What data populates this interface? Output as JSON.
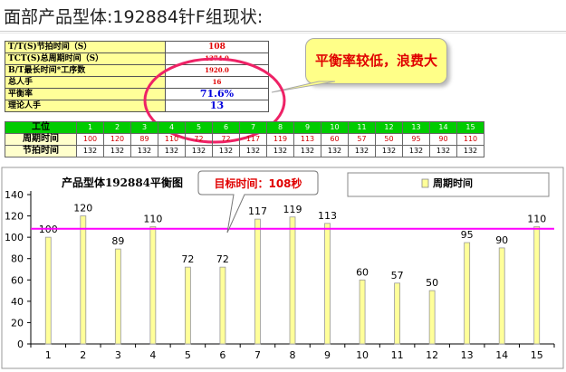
{
  "slide": {
    "title": "面部产品型体:192884针F组现状:"
  },
  "summary": [
    {
      "label": "T/T(S)节拍时间（S）",
      "value": "108"
    },
    {
      "label": "TCT(S)总周期时间（S）",
      "value": "1374.0"
    },
    {
      "label": "B/T最长时间*工序数",
      "value": "1920.0"
    },
    {
      "label": "总人手",
      "value": "16"
    },
    {
      "label": "平衡率",
      "value": "71.6%"
    },
    {
      "label": "理论人手",
      "value": "13"
    }
  ],
  "callout": {
    "text": "平衡率较低，浪费大"
  },
  "station_table": {
    "labels": {
      "station": "工位",
      "cycle": "周期时间",
      "takt": "节拍时间"
    },
    "stations": [
      "1",
      "2",
      "3",
      "4",
      "5",
      "6",
      "7",
      "8",
      "9",
      "10",
      "11",
      "12",
      "13",
      "14",
      "15"
    ],
    "cycle": [
      "100",
      "120",
      "89",
      "110",
      "72",
      "72",
      "117",
      "119",
      "113",
      "60",
      "57",
      "50",
      "95",
      "90",
      "110"
    ],
    "takt": [
      "132",
      "132",
      "132",
      "132",
      "132",
      "132",
      "132",
      "132",
      "132",
      "132",
      "132",
      "132",
      "132",
      "132",
      "132"
    ]
  },
  "chart_data": {
    "type": "bar",
    "title": "产品型体192884平衡图",
    "categories": [
      "1",
      "2",
      "3",
      "4",
      "5",
      "6",
      "7",
      "8",
      "9",
      "10",
      "11",
      "12",
      "13",
      "14",
      "15"
    ],
    "series": [
      {
        "name": "周期时间",
        "values": [
          100,
          120,
          89,
          110,
          72,
          72,
          117,
          119,
          113,
          60,
          57,
          50,
          95,
          90,
          110
        ]
      }
    ],
    "target_line": {
      "value": 108,
      "label": "目标时间：108秒"
    },
    "yticks": [
      "0",
      "20",
      "40",
      "60",
      "80",
      "100",
      "120",
      "140"
    ],
    "ylim": [
      0,
      140
    ],
    "bar_color": "#ffff99",
    "line_color": "#ff00ff",
    "grid": false,
    "legend_position": "top-right"
  }
}
